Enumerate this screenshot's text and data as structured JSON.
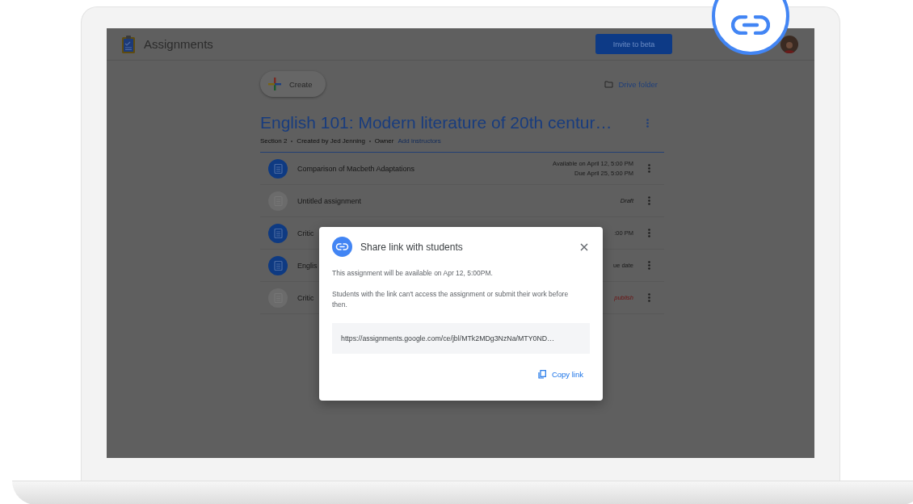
{
  "app": {
    "title": "Assignments",
    "invite_button": "Invite to beta"
  },
  "toolbar": {
    "create": "Create",
    "drive_folder": "Drive folder"
  },
  "course": {
    "title": "English 101: Modern literature of 20th centur…",
    "meta": [
      {
        "kind": "text",
        "text": "Section 2"
      },
      {
        "kind": "text",
        "text": "Created by Jed Jenning"
      },
      {
        "kind": "text",
        "text": "Owner"
      },
      {
        "kind": "link",
        "text": "Add instructors"
      }
    ]
  },
  "assignments": [
    {
      "title": "Comparison of Macbeth Adaptations",
      "kind": "published",
      "lines": [
        {
          "kind": "date",
          "text": "Available on April 12, 5:00 PM"
        },
        {
          "kind": "date",
          "text": "Due April 25, 5:00 PM"
        }
      ]
    },
    {
      "title": "Untitled assignment",
      "kind": "draft",
      "lines": [
        {
          "kind": "draft",
          "text": "Draft"
        }
      ]
    },
    {
      "title": "Critic",
      "kind": "published",
      "lines": [
        {
          "kind": "date",
          "text": ":00 PM"
        }
      ]
    },
    {
      "title": "Englis",
      "kind": "published",
      "lines": [
        {
          "kind": "date",
          "text": "ue date"
        }
      ]
    },
    {
      "title": "Critic",
      "kind": "draft",
      "lines": [
        {
          "kind": "warning",
          "text": "publish"
        }
      ]
    }
  ],
  "dialog": {
    "title": "Share link with students",
    "paragraphs": [
      "This assignment will be available on Apr 12, 5:00PM.",
      "Students with the link can't access the assignment or submit their work before then."
    ],
    "link": "https://assignments.google.com/ce/jbl/MTk2MDg3NzNa/MTY0ND…",
    "action": "Copy link"
  }
}
